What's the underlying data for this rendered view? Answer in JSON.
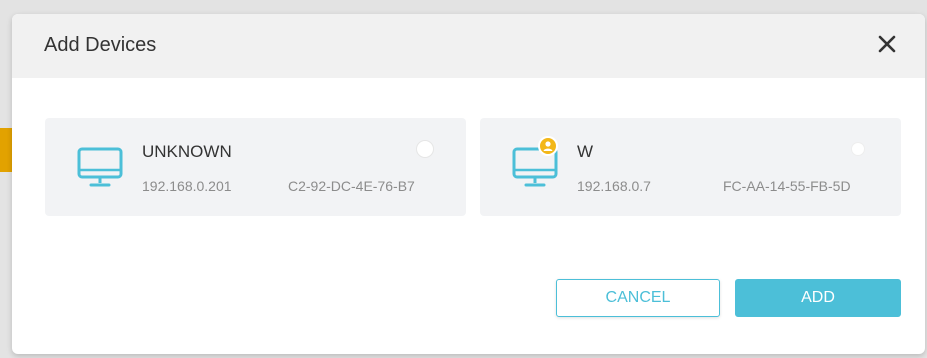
{
  "dialog": {
    "title": "Add Devices",
    "close_icon": "close-icon"
  },
  "devices": [
    {
      "name": "UNKNOWN",
      "ip": "192.168.0.201",
      "mac": "C2-92-DC-4E-76-B7",
      "icon": "monitor-icon",
      "selected": false
    },
    {
      "name": "W",
      "ip": "192.168.0.7",
      "mac": "FC-AA-14-55-FB-5D",
      "icon": "monitor-icon",
      "badge_icon": "user-badge-icon",
      "selected": false
    }
  ],
  "buttons": {
    "cancel_label": "CANCEL",
    "add_label": "ADD"
  },
  "colors": {
    "accent": "#4cbfd8",
    "badge": "#f3b718",
    "card_bg": "#f2f3f5",
    "header_bg": "#f1f1f1"
  }
}
